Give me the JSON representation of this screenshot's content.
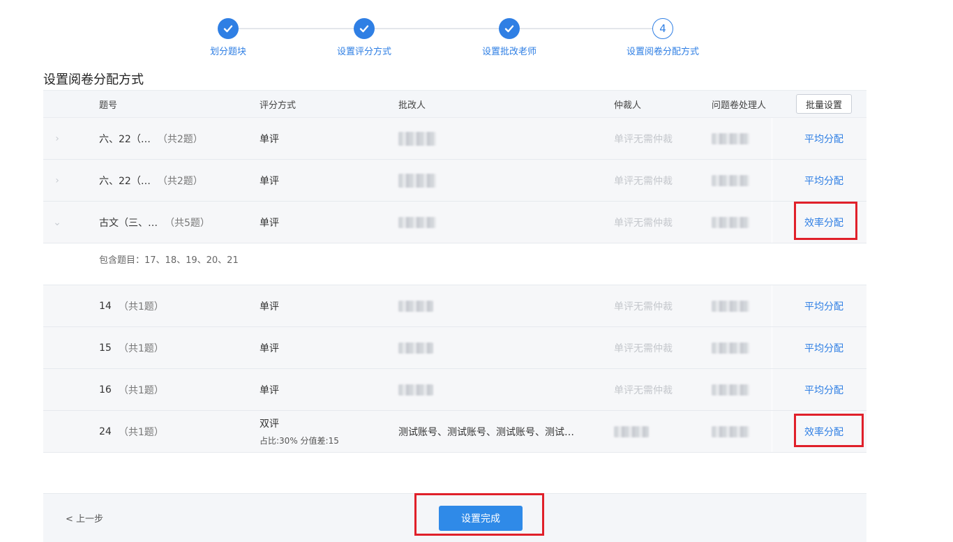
{
  "steps": [
    {
      "label": "划分题块",
      "state": "done"
    },
    {
      "label": "设置评分方式",
      "state": "done"
    },
    {
      "label": "设置批改老师",
      "state": "done"
    },
    {
      "label": "设置阅卷分配方式",
      "state": "current",
      "number": "4"
    }
  ],
  "section_title": "设置阅卷分配方式",
  "table": {
    "headers": {
      "question_no": "题号",
      "scoring": "评分方式",
      "grader": "批改人",
      "arbitrator": "仲裁人",
      "problem_handler": "问题卷处理人",
      "batch_button": "批量设置"
    },
    "rows": [
      {
        "no": "六、22（…",
        "count": "（共2题）",
        "scoring": "单评",
        "arbitrator": "单评无需仲裁",
        "action": "平均分配",
        "arrow": "›"
      },
      {
        "no": "六、22（…",
        "count": "（共2题）",
        "scoring": "单评",
        "arbitrator": "单评无需仲裁",
        "action": "平均分配",
        "arrow": "›"
      },
      {
        "no": "古文（三、…",
        "count": "（共5题）",
        "scoring": "单评",
        "arbitrator": "单评无需仲裁",
        "action": "效率分配",
        "arrow": "⌄"
      },
      {
        "no": "14",
        "count": "（共1题）",
        "scoring": "单评",
        "arbitrator": "单评无需仲裁",
        "action": "平均分配"
      },
      {
        "no": "15",
        "count": "（共1题）",
        "scoring": "单评",
        "arbitrator": "单评无需仲裁",
        "action": "平均分配"
      },
      {
        "no": "16",
        "count": "（共1题）",
        "scoring": "单评",
        "arbitrator": "单评无需仲裁",
        "action": "平均分配"
      },
      {
        "no": "24",
        "count": "（共1题）",
        "scoring": "双评",
        "scoring_sub": "占比:30% 分值差:15",
        "grader": "测试账号、测试账号、测试账号、测试…",
        "action": "效率分配"
      }
    ],
    "expanded_text": "包含题目：17、18、19、20、21"
  },
  "footer": {
    "prev_label": "< 上一步",
    "finish_label": "设置完成"
  },
  "colors": {
    "accent": "#2f7fe4",
    "highlight": "#e0202a"
  }
}
